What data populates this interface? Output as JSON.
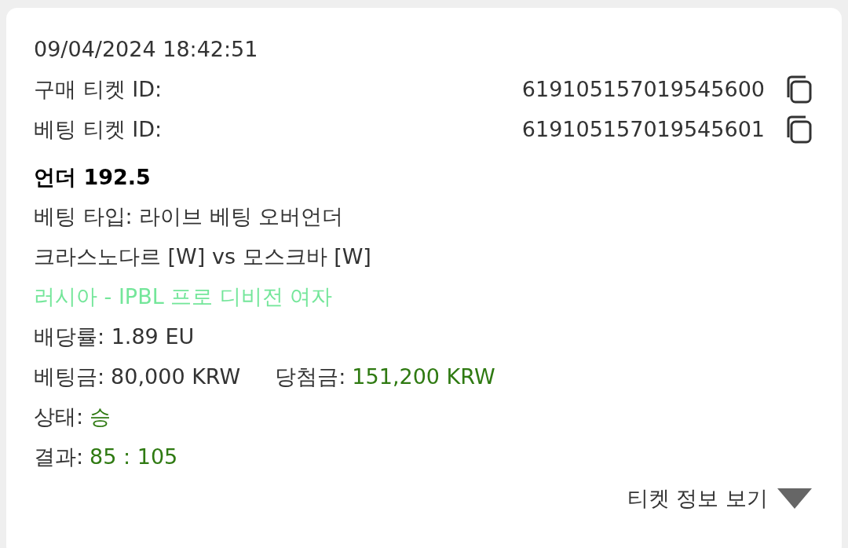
{
  "timestamp": "09/04/2024 18:42:51",
  "ids": [
    {
      "label": "구매 티켓 ID:",
      "value": "619105157019545600"
    },
    {
      "label": "베팅 티켓 ID:",
      "value": "619105157019545601"
    }
  ],
  "pick": "언더 192.5",
  "lines": [
    {
      "kind": "text",
      "text": "베팅 타입: 라이브 베팅 오버언더"
    },
    {
      "kind": "text",
      "text": "크라스노다르 [W] vs 모스크바 [W]"
    },
    {
      "kind": "league",
      "text": "러시아 - IPBL 프로 디비전 여자"
    },
    {
      "kind": "text",
      "text": "배당률: 1.89 EU"
    },
    {
      "kind": "pairs",
      "pairs": [
        {
          "label": "베팅금:",
          "value": "80,000 KRW",
          "highlight": false
        },
        {
          "label": "당첨금:",
          "value": "151,200 KRW",
          "highlight": true
        }
      ]
    },
    {
      "kind": "pairs",
      "pairs": [
        {
          "label": "상태:",
          "value": "승",
          "highlight": true
        }
      ]
    },
    {
      "kind": "pairs",
      "pairs": [
        {
          "label": "결과:",
          "value": "85 : 105",
          "highlight": true
        }
      ]
    }
  ],
  "toggle": {
    "label": "티켓 정보 보기",
    "expanded": false
  }
}
